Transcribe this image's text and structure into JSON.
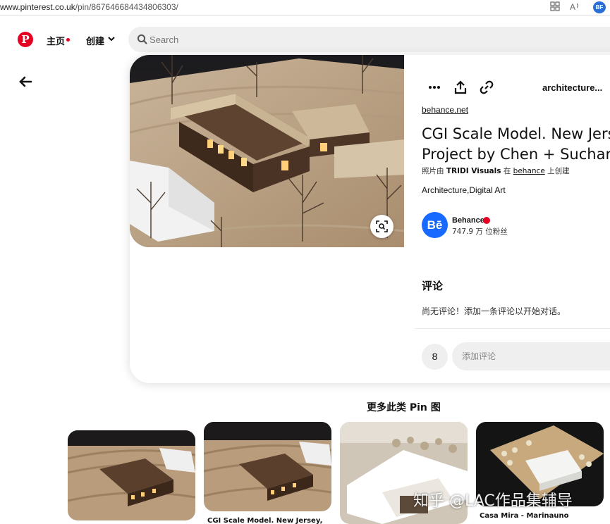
{
  "browser": {
    "url_prefix": "www.pinterest.co.uk",
    "url_path": "/pin/867646684434806303/",
    "profile_initials": "BF"
  },
  "header": {
    "logo_glyph": "P",
    "home_label": "主页",
    "create_label": "创建",
    "search_placeholder": "Search"
  },
  "pin": {
    "board_name": "architecture...",
    "source_link": "behance.net",
    "title_line1": "CGI Scale Model. New Jerse",
    "title_line2": "Project by Chen + Suchart",
    "byline_prefix": "照片由",
    "byline_author": "TRIDI Visuals",
    "byline_on": "在",
    "byline_site": "behance",
    "byline_suffix": "上创建",
    "tags": "Architecture,Digital Art",
    "creator": {
      "avatar_text": "Bē",
      "name": "Behance",
      "followers": "747.9 万 位粉丝"
    }
  },
  "comments": {
    "heading": "评论",
    "empty_text": "尚无评论！添加一条评论以开始对话。",
    "count": "8",
    "input_placeholder": "添加评论"
  },
  "more": {
    "heading": "更多此类 Pin 图",
    "tiles": [
      {
        "caption": ""
      },
      {
        "caption": "CGI Scale Model. New Jersey,"
      },
      {
        "caption": ""
      },
      {
        "caption": "Casa Mira - Marinauno"
      }
    ]
  },
  "watermark": "知乎 @LAC作品集辅导"
}
